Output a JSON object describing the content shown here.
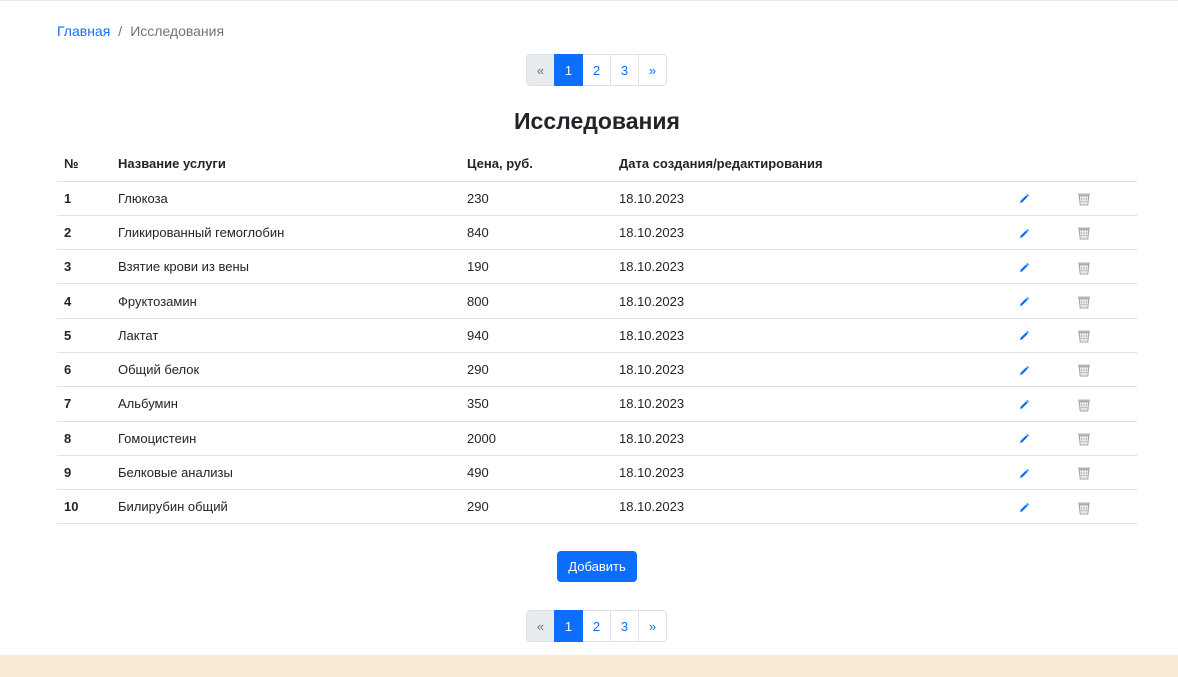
{
  "breadcrumb": {
    "home": "Главная",
    "separator": "/",
    "current": "Исследования"
  },
  "pagination": {
    "prev": "«",
    "pages": [
      "1",
      "2",
      "3"
    ],
    "active": "1",
    "next": "»"
  },
  "page_title": "Исследования",
  "table": {
    "headers": {
      "num": "№",
      "name": "Название услуги",
      "price": "Цена, руб.",
      "date": "Дата создания/редактирования"
    },
    "rows": [
      {
        "num": "1",
        "name": "Глюкоза",
        "price": "230",
        "date": "18.10.2023"
      },
      {
        "num": "2",
        "name": "Гликированный гемоглобин",
        "price": "840",
        "date": "18.10.2023"
      },
      {
        "num": "3",
        "name": "Взятие крови из вены",
        "price": "190",
        "date": "18.10.2023"
      },
      {
        "num": "4",
        "name": "Фруктозамин",
        "price": "800",
        "date": "18.10.2023"
      },
      {
        "num": "5",
        "name": "Лактат",
        "price": "940",
        "date": "18.10.2023"
      },
      {
        "num": "6",
        "name": "Общий белок",
        "price": "290",
        "date": "18.10.2023"
      },
      {
        "num": "7",
        "name": "Альбумин",
        "price": "350",
        "date": "18.10.2023"
      },
      {
        "num": "8",
        "name": "Гомоцистеин",
        "price": "2000",
        "date": "18.10.2023"
      },
      {
        "num": "9",
        "name": "Белковые анализы",
        "price": "490",
        "date": "18.10.2023"
      },
      {
        "num": "10",
        "name": "Билирубин общий",
        "price": "290",
        "date": "18.10.2023"
      }
    ]
  },
  "add_button": "Добавить",
  "icons": {
    "edit": "pencil-icon",
    "delete": "trash-icon"
  },
  "colors": {
    "accent": "#0d6efd",
    "footer": "#faebd7",
    "trash": "#9aa0a6"
  }
}
